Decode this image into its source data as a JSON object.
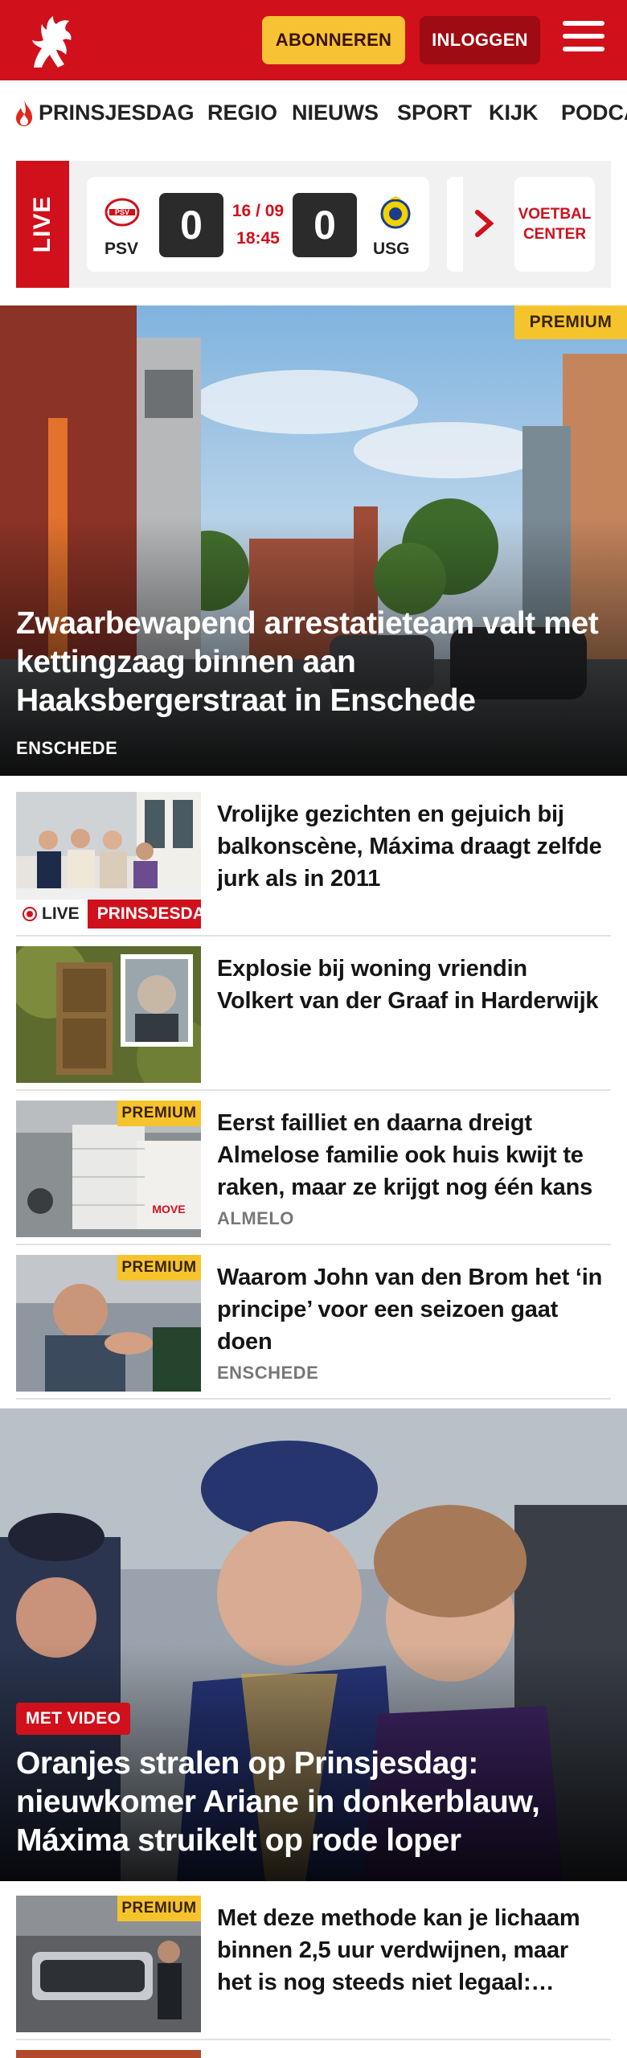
{
  "header": {
    "subscribe_label": "ABONNEREN",
    "login_label": "INLOGGEN",
    "brand_color": "#d0101b",
    "accent_color": "#f7c234",
    "logo_icon": "tubantia-horse-logo-icon",
    "menu_icon": "hamburger-menu-icon"
  },
  "nav": {
    "items": [
      "PRINSJESDAG",
      "REGIO",
      "NIEUWS",
      "SPORT",
      "KIJK",
      "PODCA"
    ],
    "first_item_icon": "flame-icon"
  },
  "scoreboard": {
    "live_label": "LIVE",
    "home_team": "PSV",
    "away_team": "USG",
    "home_score": "0",
    "away_score": "0",
    "date": "16 / 09",
    "time": "18:45",
    "center_label": "VOETBAL CENTER"
  },
  "hero": {
    "badge": "PREMIUM",
    "title": "Zwaarbewapend arrestatieteam valt met kettingzaag binnen aan Haaksbergerstraat in Enschede",
    "location": "ENSCHEDE"
  },
  "articles": [
    {
      "title": "Vrolijke gezichten en gejuich bij balkonscène, Máxima draagt zelfde jurk als in 2011",
      "live_label": "LIVE",
      "category": "PRINSJESDAG"
    },
    {
      "title": "Explosie bij woning vriendin Volkert van der Graaf in Harderwijk"
    },
    {
      "badge": "PREMIUM",
      "title": "Eerst failliet en daarna dreigt Almelose familie ook huis kwijt te raken, maar ze krijgt nog één kans",
      "location": "ALMELO"
    },
    {
      "badge": "PREMIUM",
      "title": "Waarom John van den Brom het ‘in principe’ voor een seizoen gaat doen",
      "location": "ENSCHEDE"
    }
  ],
  "hero2": {
    "video_label": "MET VIDEO",
    "title": "Oranjes stralen op Prinsjesdag: nieuwkomer Ariane in donkerblauw, Máxima struikelt op rode loper"
  },
  "article5": {
    "badge": "PREMIUM",
    "title": "Met deze methode kan je lichaam binnen 2,5 uur verdwijnen, maar het is nog steeds niet legaal: waarom?"
  }
}
